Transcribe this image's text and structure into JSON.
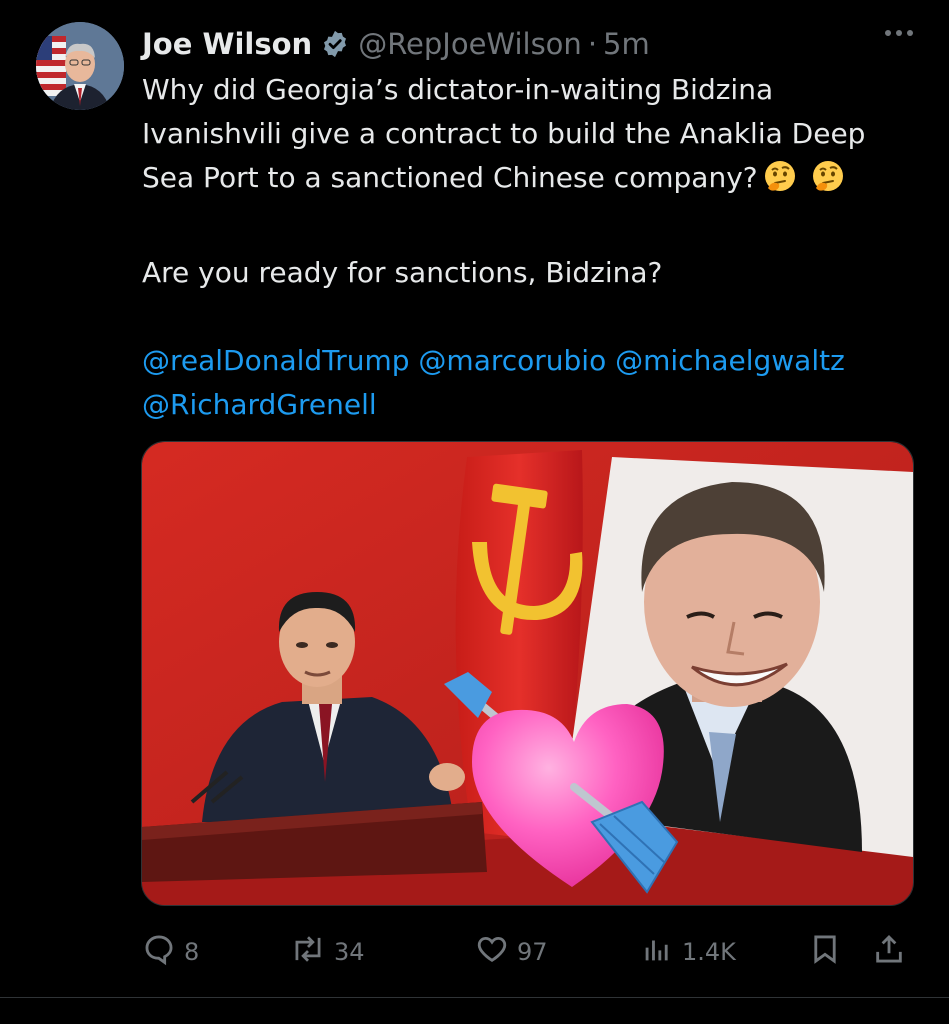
{
  "author": {
    "name": "Joe Wilson",
    "handle": "@RepJoeWilson",
    "separator": "·",
    "time": "5m",
    "verified": true
  },
  "tweet": {
    "line1": "Why did Georgia’s dictator-in-waiting Bidzina Ivanishvili give a contract to build the Anaklia Deep Sea Port to a sanctioned Chinese company?",
    "emojis": [
      "thinking-face",
      "thinking-face"
    ],
    "line2": "Are you ready for sanctions, Bidzina?",
    "mentions": [
      "@realDonaldTrump",
      "@marcorubio",
      "@michaelgwaltz",
      "@RichardGrenell"
    ]
  },
  "media": {
    "icons": [
      "hammer-and-sickle",
      "heart-with-arrow"
    ]
  },
  "actions": {
    "replies": "8",
    "reposts": "34",
    "likes": "97",
    "views": "1.4K"
  },
  "colors": {
    "background": "#000000",
    "text": "#e7e9ea",
    "secondary": "#71767b",
    "link": "#1d9bf0",
    "verified_badge": "#829aab",
    "media_red": "#c8231f",
    "heart_pink": "#ff4fb8"
  }
}
